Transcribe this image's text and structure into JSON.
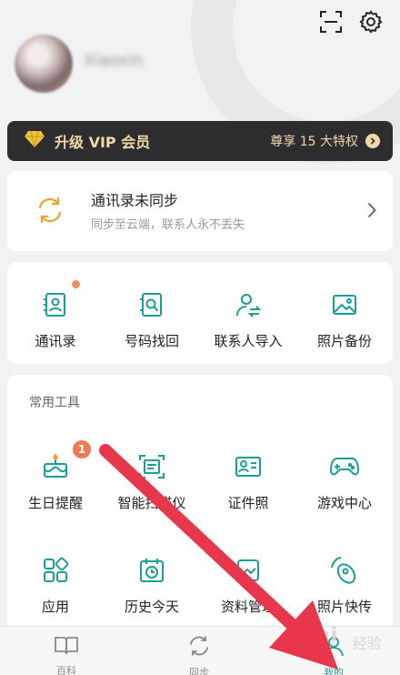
{
  "header": {
    "nickname": "Xiaoxin",
    "scan_icon": "scan-icon",
    "settings_icon": "gear-icon"
  },
  "vip": {
    "title": "升级 VIP 会员",
    "right_text": "尊享 15 大特权",
    "accent": "#f1d9a6",
    "background": "#2d2d2f"
  },
  "sync": {
    "title": "通讯录未同步",
    "subtitle": "同步至云端，联系人永不丢失"
  },
  "quick_actions": [
    {
      "label": "通讯录",
      "icon": "contacts-icon",
      "dot": true
    },
    {
      "label": "号码找回",
      "icon": "number-recovery-icon"
    },
    {
      "label": "联系人导入",
      "icon": "contact-import-icon"
    },
    {
      "label": "照片备份",
      "icon": "photo-backup-icon"
    }
  ],
  "tools": {
    "title": "常用工具",
    "items": [
      {
        "label": "生日提醒",
        "icon": "birthday-cake-icon",
        "badge": "1"
      },
      {
        "label": "智能扫描仪",
        "icon": "smart-scanner-icon"
      },
      {
        "label": "证件照",
        "icon": "id-photo-icon"
      },
      {
        "label": "游戏中心",
        "icon": "gamepad-icon"
      },
      {
        "label": "应用",
        "icon": "apps-icon"
      },
      {
        "label": "历史今天",
        "icon": "history-today-icon"
      },
      {
        "label": "资料管理",
        "icon": "data-manage-icon"
      },
      {
        "label": "照片快传",
        "icon": "photo-transfer-icon"
      }
    ]
  },
  "tabbar": {
    "tabs": [
      {
        "label": "百科",
        "icon": "book-icon"
      },
      {
        "label": "同步",
        "icon": "sync-icon"
      },
      {
        "label": "我的",
        "icon": "profile-icon",
        "active": true
      }
    ]
  },
  "colors": {
    "accent_teal": "#1a9e95",
    "accent_orange": "#f0a030",
    "annotation_arrow": "#e8374a"
  },
  "watermark": {
    "text": "Bai",
    "text_cn": "经验"
  }
}
